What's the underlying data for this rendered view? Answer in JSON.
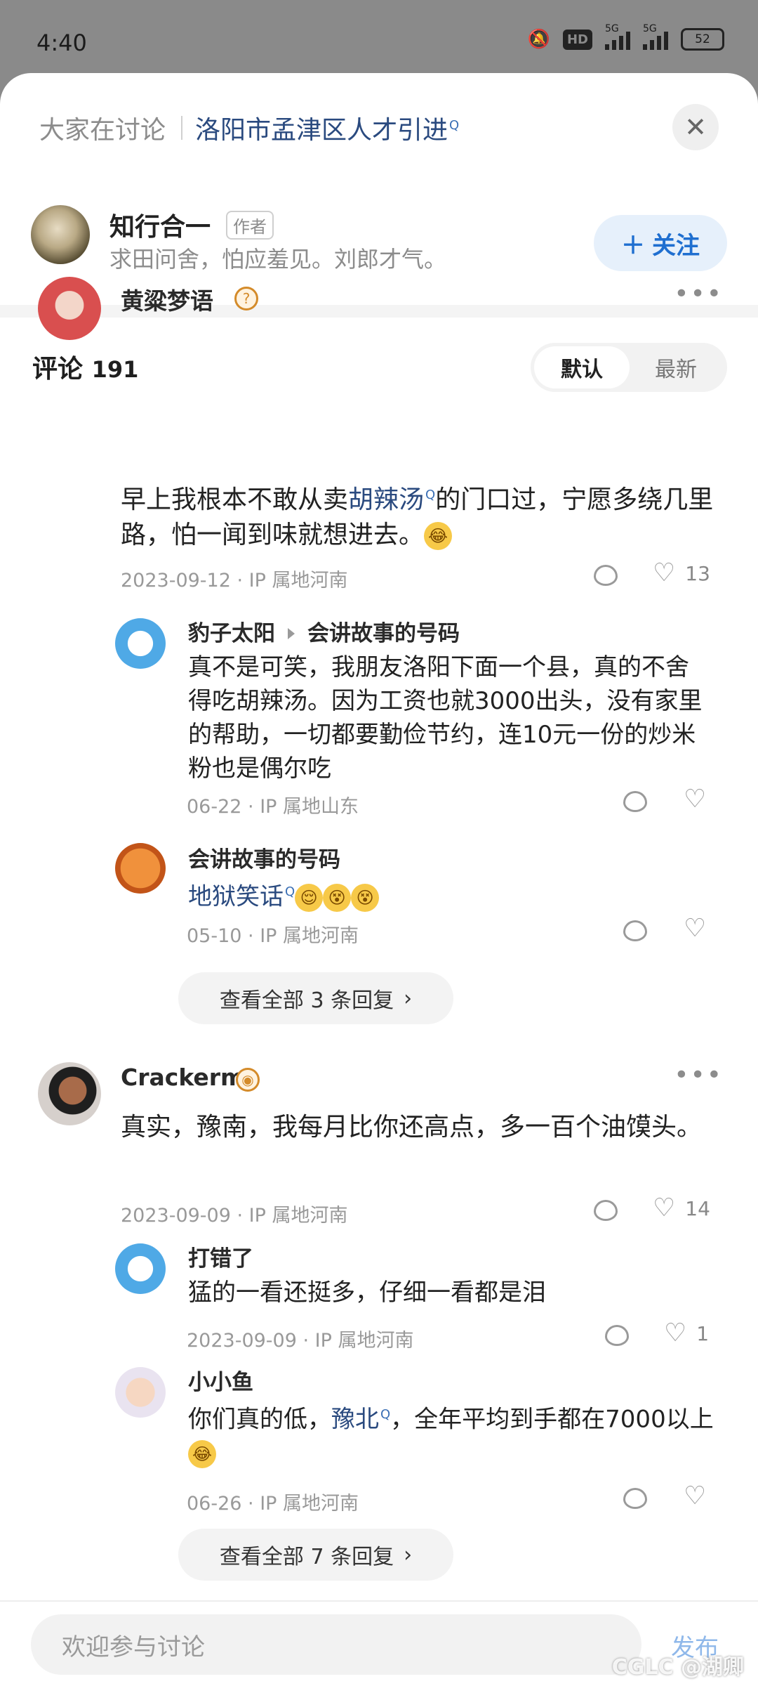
{
  "status_bar": {
    "time": "4:40",
    "network_hd": "HD",
    "net1": "5G",
    "net2": "5G",
    "battery": "52"
  },
  "topic": {
    "label": "大家在讨论",
    "link": "洛阳市孟津区人才引进",
    "close_icon": "close-icon"
  },
  "author": {
    "name": "知行合一",
    "badge": "作者",
    "bio": "求田问舍，怕应羞见。刘郎才气。",
    "follow_label": "关注"
  },
  "comments_header": {
    "title": "评论",
    "count": "191",
    "sort_default": "默认",
    "sort_latest": "最新"
  },
  "threads": [
    {
      "user": "黄粱梦语",
      "text_before": "早上我根本不敢从卖",
      "text_link": "胡辣汤",
      "text_after": "的门口过，宁愿多绕几里路，怕一闻到味就想进去。",
      "meta": "2023-09-12 · IP 属地河南",
      "likes": "13",
      "replies": [
        {
          "user": "豹子太阳",
          "reply_to": "会讲故事的号码",
          "text": "真不是可笑，我朋友洛阳下面一个县，真的不舍得吃胡辣汤。因为工资也就3000出头，没有家里的帮助，一切都要勤俭节约，连10元一份的炒米粉也是偶尔吃",
          "meta": "06-22 · IP 属地山东"
        },
        {
          "user": "会讲故事的号码",
          "text_link": "地狱笑话",
          "meta": "05-10 · IP 属地河南"
        }
      ],
      "view_all": "查看全部 3 条回复"
    },
    {
      "user": "Crackerme",
      "text": "真实，豫南，我每月比你还高点，多一百个油馍头。",
      "meta": "2023-09-09 · IP 属地河南",
      "likes": "14",
      "replies": [
        {
          "user": "打错了",
          "text": "猛的一看还挺多，仔细一看都是泪",
          "meta": "2023-09-09 · IP 属地河南",
          "likes": "1"
        },
        {
          "user": "小小鱼",
          "text_before": "你们真的低，",
          "text_link": "豫北",
          "text_after": "，全年平均到手都在7000以上",
          "meta": "06-26 · IP 属地河南"
        }
      ],
      "view_all": "查看全部 7 条回复"
    }
  ],
  "input": {
    "placeholder": "欢迎参与讨论",
    "send_label": "发布"
  },
  "watermark": "CGLC @湖卿"
}
